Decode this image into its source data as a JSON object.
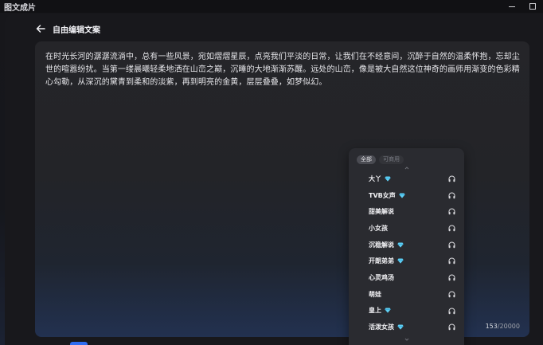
{
  "app": {
    "title": "图文成片"
  },
  "window_controls": {
    "minimize": "",
    "maximize": ""
  },
  "header": {
    "title": "自由编辑文案"
  },
  "editor": {
    "text": "在时光长河的潺潺流淌中，总有一些风景，宛如熠熠星辰，点亮我们平淡的日常，让我们在不经意间，沉醉于自然的温柔怀抱，忘却尘世的喧嚣纷扰。当第一缕晨曦轻柔地洒在山峦之巅，沉睡的大地渐渐苏醒。远处的山峦，像是被大自然这位神奇的画师用渐变的色彩精心勾勒，从深沉的黛青到柔和的淡紫，再到明亮的金黄，层层叠叠，如梦似幻。",
    "char_count": "153",
    "char_limit": "/20000"
  },
  "voice_panel": {
    "filters": [
      {
        "label": "全部",
        "active": true
      },
      {
        "label": "可商用",
        "active": false
      }
    ],
    "voices": [
      {
        "name": "大丫",
        "premium": true
      },
      {
        "name": "TVB女声",
        "premium": true
      },
      {
        "name": "甜美解说",
        "premium": false
      },
      {
        "name": "小女孩",
        "premium": false
      },
      {
        "name": "沉稳解说",
        "premium": true
      },
      {
        "name": "开朗弟弟",
        "premium": true
      },
      {
        "name": "心灵鸡汤",
        "premium": false
      },
      {
        "name": "萌娃",
        "premium": false
      },
      {
        "name": "皇上",
        "premium": true
      },
      {
        "name": "活泼女孩",
        "premium": true
      }
    ],
    "icons": {
      "premium": "gem-icon",
      "preview": "headphones-icon"
    }
  },
  "colors": {
    "accent": "#2f6cf0",
    "gem": "#5fd0f5",
    "panel": "#2a2b30"
  }
}
